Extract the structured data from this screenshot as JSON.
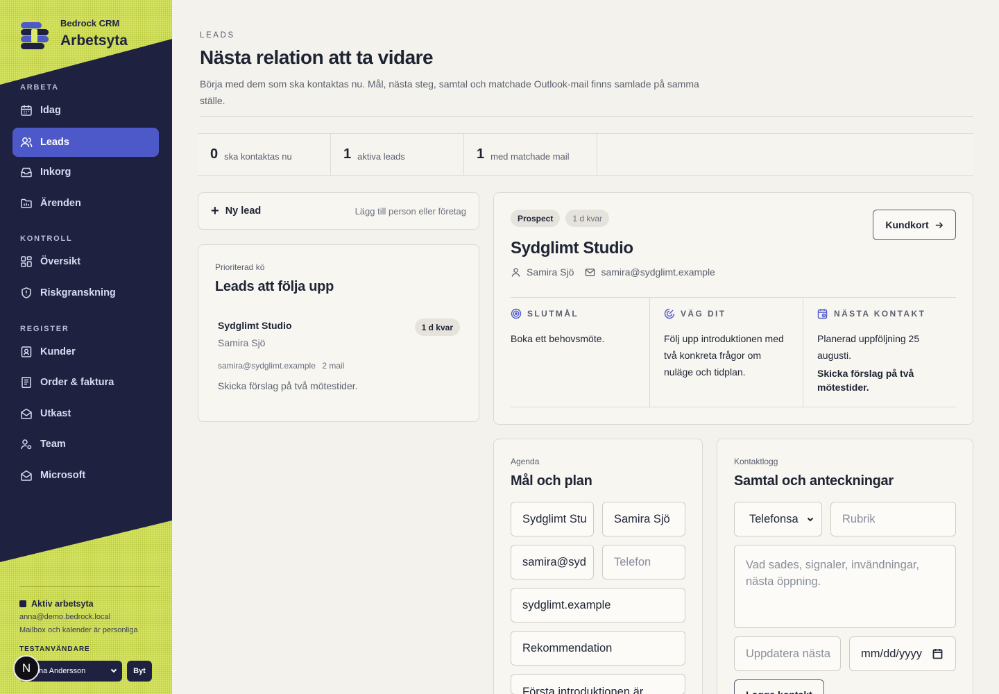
{
  "brand": {
    "subtitle": "Bedrock CRM",
    "title": "Arbetsyta"
  },
  "nav": {
    "sections": [
      {
        "label": "ARBETA",
        "items": [
          {
            "label": "Idag",
            "icon": "calendar-icon"
          },
          {
            "label": "Leads",
            "icon": "users-icon",
            "active": true
          },
          {
            "label": "Inkorg",
            "icon": "inbox-icon"
          },
          {
            "label": "Ärenden",
            "icon": "folder-icon"
          }
        ]
      },
      {
        "label": "KONTROLL",
        "items": [
          {
            "label": "Översikt",
            "icon": "grid-icon"
          },
          {
            "label": "Riskgranskning",
            "icon": "shield-icon"
          }
        ]
      },
      {
        "label": "REGISTER",
        "items": [
          {
            "label": "Kunder",
            "icon": "contact-card-icon"
          },
          {
            "label": "Order & faktura",
            "icon": "receipt-icon"
          },
          {
            "label": "Utkast",
            "icon": "envelope-icon"
          },
          {
            "label": "Team",
            "icon": "team-icon"
          },
          {
            "label": "Microsoft",
            "icon": "envelope-open-icon"
          }
        ]
      }
    ]
  },
  "workspace": {
    "status": "Aktiv arbetsyta",
    "email": "anna@demo.bedrock.local",
    "note": "Mailbox och kalender är personliga",
    "test_label": "TESTANVÄNDARE",
    "selected_user": "na Andersson",
    "switch_label": "Byt",
    "badge": "N"
  },
  "header": {
    "eyebrow": "LEADS",
    "title": "Nästa relation att ta vidare",
    "description": "Börja med dem som ska kontaktas nu. Mål, nästa steg, samtal och matchade Outlook-mail finns samlade på samma ställe."
  },
  "stats": [
    {
      "value": "0",
      "label": "ska kontaktas nu"
    },
    {
      "value": "1",
      "label": "aktiva leads"
    },
    {
      "value": "1",
      "label": "med matchade mail"
    }
  ],
  "new_lead": {
    "label": "Ny lead",
    "hint": "Lägg till person eller företag"
  },
  "queue": {
    "eyebrow": "Prioriterad kö",
    "title": "Leads att följa upp",
    "items": [
      {
        "company": "Sydglimt Studio",
        "person": "Samira Sjö",
        "email": "samira@sydglimt.example",
        "mail_count": "2 mail",
        "badge": "1 d kvar",
        "next": "Skicka förslag på två mötestider."
      }
    ]
  },
  "detail": {
    "status": "Prospect",
    "due": "1 d kvar",
    "button": "Kundkort",
    "company": "Sydglimt Studio",
    "person": "Samira Sjö",
    "email": "samira@sydglimt.example",
    "goal_head": "SLUTMÅL",
    "goal": "Boka ett behovsmöte.",
    "path_head": "VÄG DIT",
    "path": "Följ upp introduktionen med två konkreta frågor om nuläge och tidplan.",
    "next_head": "NÄSTA KONTAKT",
    "next_planned": "Planerad uppföljning 25 augusti.",
    "next_action": "Skicka förslag på två mötestider."
  },
  "agenda": {
    "eyebrow": "Agenda",
    "title": "Mål och plan",
    "company_value": "Sydglimt Stu",
    "person_value": "Samira Sjö",
    "email_value": "samira@syd",
    "phone_placeholder": "Telefon",
    "domain_value": "sydglimt.example",
    "source_value": "Rekommendation",
    "goal_value": "Första introduktionen är"
  },
  "kontaktlogg": {
    "eyebrow": "Kontaktlogg",
    "title": "Samtal och anteckningar",
    "type_value": "Telefonsa",
    "subject_placeholder": "Rubrik",
    "notes_placeholder": "Vad sades, signaler, invändningar, nästa öppning.",
    "next_placeholder": "Uppdatera nästa",
    "date_placeholder": "mm/dd/yyyy",
    "submit": "Logga kontakt"
  },
  "colors": {
    "sidebar": "#1e2140",
    "accent": "#4e59c9",
    "lime": "#dcea6a",
    "background": "#f4f2ec"
  }
}
